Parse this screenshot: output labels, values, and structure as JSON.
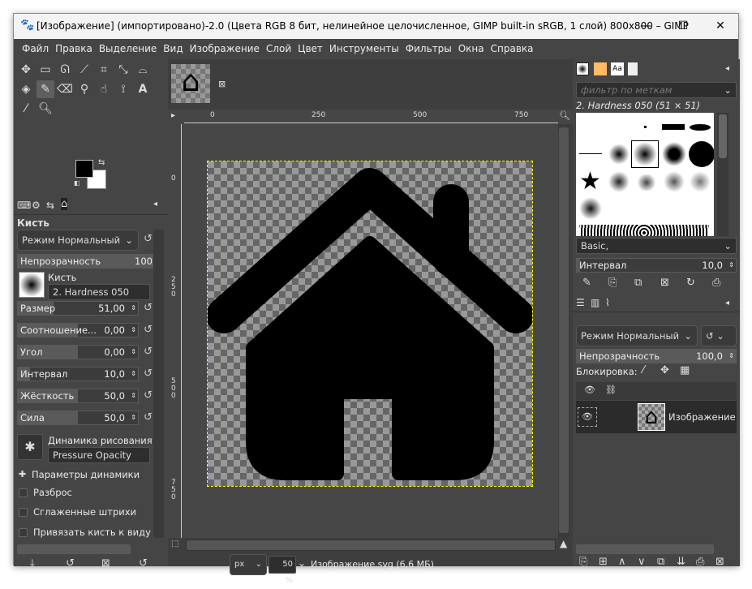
{
  "window": {
    "title": "[Изображение] (импортировано)-2.0 (Цвета RGB 8 бит, нелинейное целочисленное, GIMP built-in sRGB, 1 слой) 800x800 – GIMP",
    "minimize": "—",
    "maximize": "☐",
    "close": "✕"
  },
  "menu": [
    "Файл",
    "Правка",
    "Выделение",
    "Вид",
    "Изображение",
    "Слой",
    "Цвет",
    "Инструменты",
    "Фильтры",
    "Окна",
    "Справка"
  ],
  "tool_options": {
    "title": "Кисть",
    "mode": "Режим Нормальный",
    "opacity_label": "Непрозрачность",
    "opacity_value": "100",
    "brush_label": "Кисть",
    "brush_name": "2. Hardness 050",
    "sliders": [
      {
        "label": "Размер",
        "value": "51,00",
        "fill": 0.3
      },
      {
        "label": "Соотношение...",
        "value": "0,00",
        "fill": 0.5
      },
      {
        "label": "Угол",
        "value": "0,00",
        "fill": 0.5
      },
      {
        "label": "Интервал",
        "value": "10,0",
        "fill": 0.1
      },
      {
        "label": "Жёсткость",
        "value": "50,0",
        "fill": 0.5
      },
      {
        "label": "Сила",
        "value": "50,0",
        "fill": 0.5
      }
    ],
    "dynamics_label": "Динамика рисования",
    "dynamics_value": "Pressure Opacity",
    "dynamics_options": "Параметры динамики",
    "checks": [
      "Разброс",
      "Сглаженные штрихи",
      "Привязать кисть к виду"
    ]
  },
  "canvas": {
    "ruler_h": [
      "0",
      "250",
      "500",
      "750"
    ],
    "ruler_v": [
      "0",
      "250",
      "500",
      "750"
    ],
    "unit": "px",
    "zoom": "50 %",
    "status": "Изображение.svg (6,6 МБ)"
  },
  "brushes": {
    "filter_placeholder": "фильтр по меткам",
    "current": "2. Hardness 050 (51 × 51)",
    "tag": "Basic,",
    "spacing_label": "Интервал",
    "spacing_value": "10,0"
  },
  "layers": {
    "mode": "Режим Нормальный",
    "opacity_label": "Непрозрачность",
    "opacity_value": "100,0",
    "lock_label": "Блокировка:",
    "layer_name": "Изображение"
  }
}
